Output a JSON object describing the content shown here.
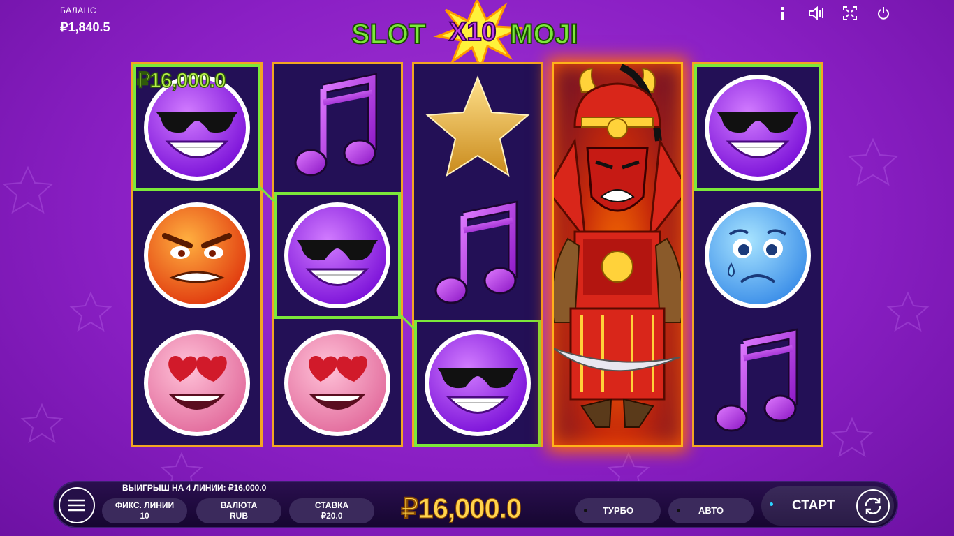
{
  "header": {
    "balance_label": "БАЛАНС",
    "balance_value": "₽1,840.5",
    "logo_left": "SLOT",
    "logo_multiplier": "X10",
    "logo_right": "MOJI",
    "icons": [
      "info-icon",
      "sound-icon",
      "fullscreen-icon",
      "power-icon"
    ]
  },
  "reels": [
    [
      "sunglasses-emoji",
      "angry-emoji",
      "heart-eyes-emoji"
    ],
    [
      "music-note",
      "sunglasses-emoji",
      "heart-eyes-emoji"
    ],
    [
      "star",
      "music-note",
      "sunglasses-emoji"
    ],
    [
      "samurai-wild"
    ],
    [
      "sunglasses-emoji",
      "sad-emoji",
      "music-note"
    ]
  ],
  "win": {
    "amount_on_reel": "₽16,000.0",
    "lines_text": "ВЫИГРЫШ НА 4 ЛИНИИ: ₽16,000.0",
    "total": "₽16,000.0"
  },
  "controls": {
    "lines_label": "ФИКС. ЛИНИИ",
    "lines_value": "10",
    "currency_label": "ВАЛЮТА",
    "currency_value": "RUB",
    "bet_label": "СТАВКА",
    "bet_value": "₽20.0",
    "turbo_label": "ТУРБО",
    "auto_label": "АВТО",
    "start_label": "СТАРТ"
  },
  "colors": {
    "background": "#8a1fc4",
    "reel_border": "#f2a623",
    "win_outline": "#7ce83a",
    "total_win": "#ffd34d"
  }
}
